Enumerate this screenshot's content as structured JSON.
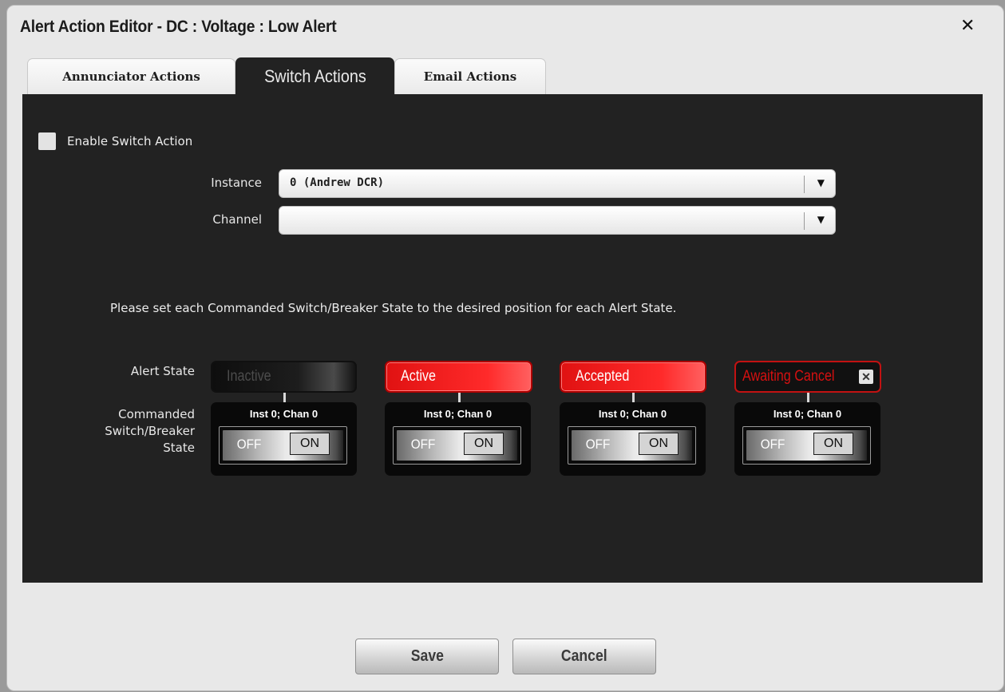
{
  "dialog": {
    "title": "Alert Action Editor  - DC : Voltage : Low Alert",
    "close_icon": "close-icon"
  },
  "tabs": [
    {
      "label": "Annunciator Actions",
      "active": false
    },
    {
      "label": "Switch Actions",
      "active": true
    },
    {
      "label": "Email Actions",
      "active": false
    }
  ],
  "switch_actions": {
    "enable_label": "Enable Switch Action",
    "enable_checked": false,
    "instance": {
      "label": "Instance",
      "value": "0 (Andrew DCR)"
    },
    "channel": {
      "label": "Channel",
      "value": ""
    },
    "instruction": "Please set each Commanded Switch/Breaker State to the desired position for each Alert State.",
    "alert_state_label": "Alert State",
    "commanded_label_lines": [
      "Commanded",
      "Switch/Breaker",
      "State"
    ],
    "states": [
      {
        "label": "Inactive",
        "caption": "Inst 0; Chan 0",
        "off_label": "OFF",
        "on_label": "ON"
      },
      {
        "label": "Active",
        "caption": "Inst 0; Chan 0",
        "off_label": "OFF",
        "on_label": "ON"
      },
      {
        "label": "Accepted",
        "caption": "Inst 0; Chan 0",
        "off_label": "OFF",
        "on_label": "ON"
      },
      {
        "label": "Awaiting Cancel",
        "caption": "Inst 0; Chan 0",
        "off_label": "OFF",
        "on_label": "ON"
      }
    ]
  },
  "footer": {
    "save_label": "Save",
    "cancel_label": "Cancel"
  },
  "colors": {
    "panel_bg": "#222222",
    "alert_red": "#ff1e1e",
    "dialog_bg": "#e8e8e8"
  }
}
